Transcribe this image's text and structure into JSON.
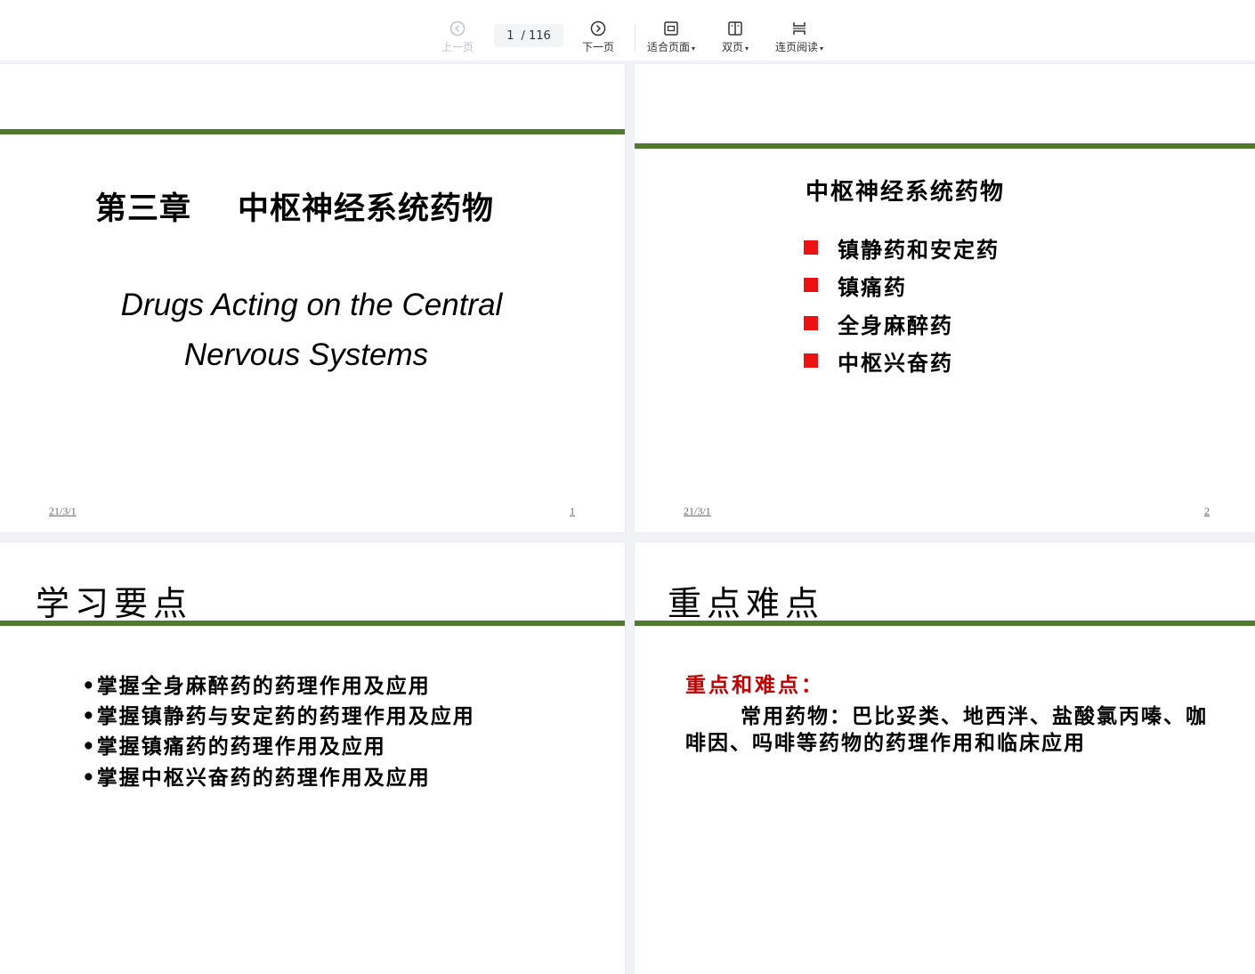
{
  "toolbar": {
    "prev_label": "上一页",
    "current_page": "1",
    "total_pages": "/ 116",
    "next_label": "下一页",
    "fit_label": "适合页面",
    "double_label": "双页",
    "continuous_label": "连页阅读"
  },
  "slides": [
    {
      "title_zh_1": "第三章",
      "title_zh_2": "中枢神经系统药物",
      "title_en_1": "Drugs Acting on the Central",
      "title_en_2": "Nervous Systems",
      "date": "21/3/1",
      "number": "1"
    },
    {
      "title": "中枢神经系统药物",
      "items": [
        "镇静药和安定药",
        "镇痛药",
        "全身麻醉药",
        "中枢兴奋药"
      ],
      "date": "21/3/1",
      "number": "2"
    },
    {
      "title": "学习要点",
      "items": [
        "•掌握全身麻醉药的药理作用及应用",
        "•掌握镇静药与安定药的药理作用及应用",
        "•掌握镇痛药的药理作用及应用",
        "•掌握中枢兴奋药的药理作用及应用"
      ]
    },
    {
      "title": "重点难点",
      "subtitle": "重点和难点：",
      "body": "常用药物：巴比妥类、地西泮、盐酸氯丙嗪、咖啡因、吗啡等药物的药理作用和临床应用"
    }
  ],
  "colors": {
    "green_bar": "#4f7a30",
    "bullet_red": "#ee1111",
    "accent_red": "#c00000"
  }
}
